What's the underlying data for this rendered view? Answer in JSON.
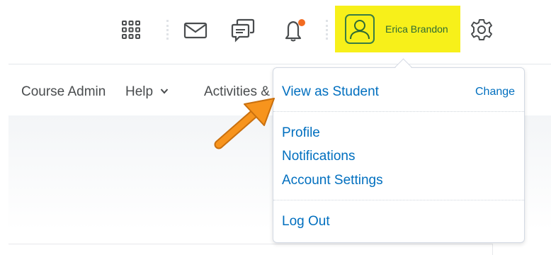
{
  "header": {
    "user_name": "Erica Brandon",
    "icons": [
      "waffle-icon",
      "mail-icon",
      "chat-icon",
      "bell-icon",
      "avatar-icon",
      "gear-icon"
    ],
    "notification_dot_color": "#f26b21",
    "highlight_color": "#f7f01a"
  },
  "nav": {
    "items": [
      "Course Admin",
      "Help",
      "Activities &"
    ]
  },
  "dropdown": {
    "view_as": "View as Student",
    "change": "Change",
    "links": [
      "Profile",
      "Notifications",
      "Account Settings"
    ],
    "logout": "Log Out",
    "link_color": "#006fbf"
  }
}
